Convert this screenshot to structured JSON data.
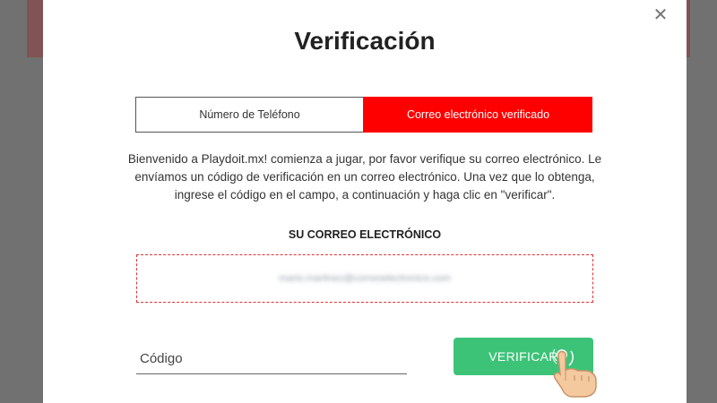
{
  "modal": {
    "close_icon": "close-icon",
    "title": "Verificación",
    "tabs": [
      {
        "label": "Número de Teléfono",
        "active": false
      },
      {
        "label": "Correo electrónico verificado",
        "active": true
      }
    ],
    "description": "Bienvenido a Playdoit.mx! comienza a jugar, por favor verifique su correo electrónico. Le envíamos un código de verificación en un correo electrónico. Una vez que lo obtenga, ingrese el código en el campo, a continuación y haga clic en \"verificar\".",
    "email_label": "SU CORREO ELECTRÓNICO",
    "email_value": "mario.martinez@correoelectronico.com",
    "code_placeholder": "Código",
    "verify_label": "VERIFICAR"
  },
  "colors": {
    "accent": "#ff0000",
    "button": "#3dc378"
  }
}
